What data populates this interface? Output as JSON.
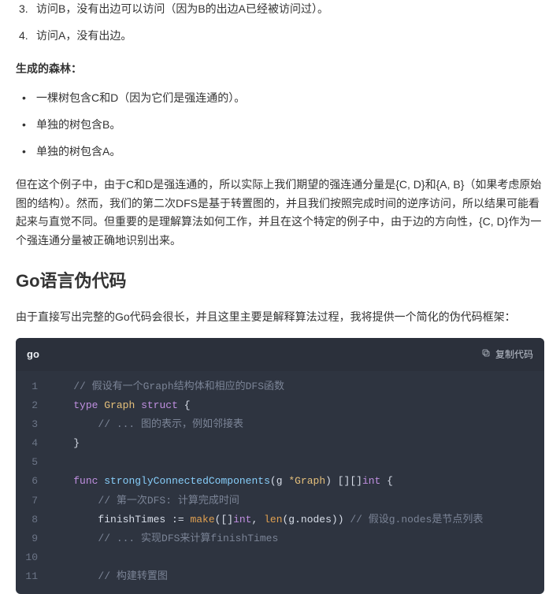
{
  "steps": [
    {
      "num": "3.",
      "text": "访问B，没有出边可以访问（因为B的出边A已经被访问过）。"
    },
    {
      "num": "4.",
      "text": "访问A，没有出边。"
    }
  ],
  "forest_heading": "生成的森林：",
  "forest_items": [
    "一棵树包含C和D（因为它们是强连通的）。",
    "单独的树包含B。",
    "单独的树包含A。"
  ],
  "para": "但在这个例子中，由于C和D是强连通的，所以实际上我们期望的强连通分量是{C, D}和{A, B}（如果考虑原始图的结构）。然而，我们的第二次DFS是基于转置图的，并且我们按照完成时间的逆序访问，所以结果可能看起来与直觉不同。但重要的是理解算法如何工作，并且在这个特定的例子中，由于边的方向性，{C, D}作为一个强连通分量被正确地识别出来。",
  "section_heading": "Go语言伪代码",
  "section_intro": "由于直接写出完整的Go代码会很长，并且这里主要是解释算法过程，我将提供一个简化的伪代码框架：",
  "code": {
    "lang": "go",
    "copy_label": "复制代码",
    "lines": [
      {
        "n": 1,
        "tokens": [
          {
            "t": "    ",
            "c": ""
          },
          {
            "t": "// 假设有一个Graph结构体和相应的DFS函数",
            "c": "comment"
          }
        ]
      },
      {
        "n": 2,
        "tokens": [
          {
            "t": "    ",
            "c": ""
          },
          {
            "t": "type",
            "c": "keyword"
          },
          {
            "t": " ",
            "c": ""
          },
          {
            "t": "Graph",
            "c": "type"
          },
          {
            "t": " ",
            "c": ""
          },
          {
            "t": "struct",
            "c": "keyword"
          },
          {
            "t": " {",
            "c": "punct"
          }
        ]
      },
      {
        "n": 3,
        "tokens": [
          {
            "t": "        ",
            "c": ""
          },
          {
            "t": "// ... 图的表示，例如邻接表",
            "c": "comment"
          }
        ]
      },
      {
        "n": 4,
        "tokens": [
          {
            "t": "    ",
            "c": ""
          },
          {
            "t": "}",
            "c": "punct"
          }
        ]
      },
      {
        "n": 5,
        "tokens": [
          {
            "t": " ",
            "c": ""
          }
        ]
      },
      {
        "n": 6,
        "tokens": [
          {
            "t": "    ",
            "c": ""
          },
          {
            "t": "func",
            "c": "keyword"
          },
          {
            "t": " ",
            "c": ""
          },
          {
            "t": "stronglyConnectedComponents",
            "c": "func"
          },
          {
            "t": "(",
            "c": "punct"
          },
          {
            "t": "g ",
            "c": "ident"
          },
          {
            "t": "*Graph",
            "c": "funcname"
          },
          {
            "t": ") [][]",
            "c": "punct"
          },
          {
            "t": "int",
            "c": "keyword"
          },
          {
            "t": " {",
            "c": "punct"
          }
        ]
      },
      {
        "n": 7,
        "tokens": [
          {
            "t": "        ",
            "c": ""
          },
          {
            "t": "// 第一次DFS: 计算完成时间",
            "c": "comment"
          }
        ]
      },
      {
        "n": 8,
        "tokens": [
          {
            "t": "        ",
            "c": ""
          },
          {
            "t": "finishTimes := ",
            "c": "ident"
          },
          {
            "t": "make",
            "c": "builtin"
          },
          {
            "t": "([]",
            "c": "punct"
          },
          {
            "t": "int",
            "c": "keyword"
          },
          {
            "t": ", ",
            "c": "punct"
          },
          {
            "t": "len",
            "c": "builtin"
          },
          {
            "t": "(g.nodes)) ",
            "c": "punct"
          },
          {
            "t": "// 假设g.nodes是节点列表",
            "c": "comment"
          }
        ]
      },
      {
        "n": 9,
        "tokens": [
          {
            "t": "        ",
            "c": ""
          },
          {
            "t": "// ... 实现DFS来计算finishTimes",
            "c": "comment"
          }
        ]
      },
      {
        "n": 10,
        "tokens": [
          {
            "t": " ",
            "c": ""
          }
        ]
      },
      {
        "n": 11,
        "tokens": [
          {
            "t": "        ",
            "c": ""
          },
          {
            "t": "// 构建转置图",
            "c": "comment"
          }
        ]
      }
    ]
  }
}
